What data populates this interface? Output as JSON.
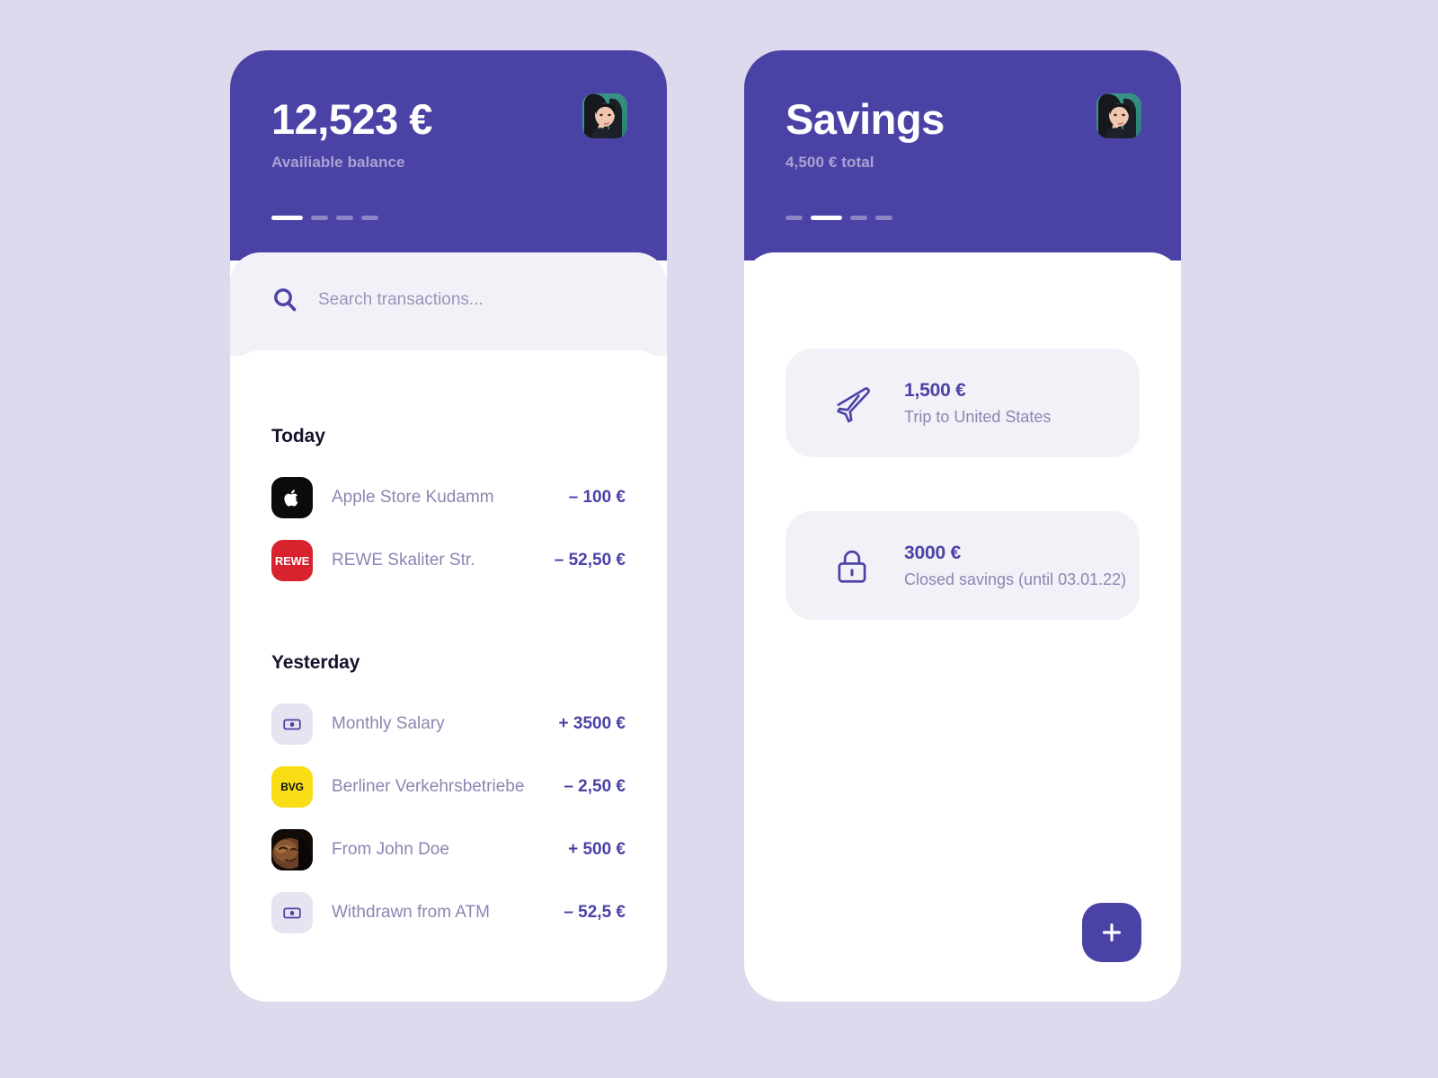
{
  "theme": {
    "background": "#dcdaec",
    "brand_purple": "#4b42a6",
    "panel_light": "#f2f1f8",
    "muted_text": "#8b86b2",
    "dot_inactive": "#8d86c4"
  },
  "screens": [
    {
      "id": "balance",
      "header": {
        "title": "12,523 €",
        "subtitle": "Availiable balance",
        "avatar_name": "user-avatar"
      },
      "pagination": {
        "count": 4,
        "active_index": 0
      },
      "search": {
        "icon": "search-icon",
        "placeholder": "Search transactions...",
        "value": ""
      },
      "transaction_groups": [
        {
          "title": "Today",
          "items": [
            {
              "logo": "apple-logo",
              "logo_kind": "apple",
              "logo_text": "",
              "label": "Apple Store Kudamm",
              "amount": "– 100 €"
            },
            {
              "logo": "rewe-logo",
              "logo_kind": "rewe",
              "logo_text": "REWE",
              "label": "REWE Skaliter Str.",
              "amount": "– 52,50 €"
            }
          ]
        },
        {
          "title": "Yesterday",
          "items": [
            {
              "logo": "banknote-icon",
              "logo_kind": "cash",
              "logo_text": "",
              "label": "Monthly Salary",
              "amount": "+ 3500 €"
            },
            {
              "logo": "bvg-logo",
              "logo_kind": "bvg",
              "logo_text": "BVG",
              "label": "Berliner Verkehrsbetriebe",
              "amount": "– 2,50 €"
            },
            {
              "logo": "contact-avatar",
              "logo_kind": "photo",
              "logo_text": "",
              "label": "From John Doe",
              "amount": "+ 500 €"
            },
            {
              "logo": "banknote-icon",
              "logo_kind": "cash",
              "logo_text": "",
              "label": "Withdrawn from ATM",
              "amount": "– 52,5 €"
            }
          ]
        }
      ]
    },
    {
      "id": "savings",
      "header": {
        "title": "Savings",
        "subtitle": "4,500 € total",
        "avatar_name": "user-avatar"
      },
      "pagination": {
        "count": 4,
        "active_index": 1
      },
      "savings_cards": [
        {
          "icon": "airplane-icon",
          "amount": "1,500 €",
          "description": "Trip to United States"
        },
        {
          "icon": "lock-icon",
          "amount": "3000 €",
          "description": "Closed savings (until 03.01.22)"
        }
      ],
      "fab": {
        "icon": "plus-icon",
        "label": "+"
      }
    }
  ]
}
